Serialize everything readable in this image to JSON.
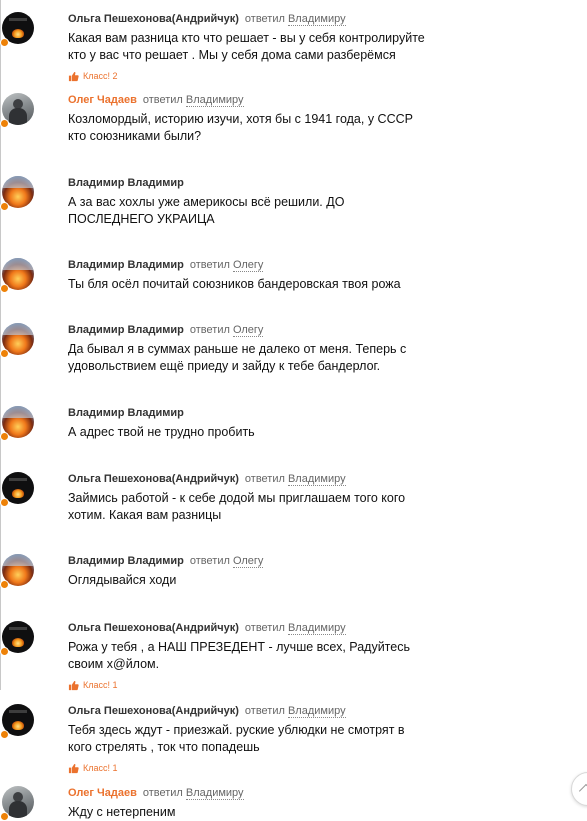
{
  "comments": [
    {
      "author": "Ольга Пешехонова(Андрийчук)",
      "author_orange": false,
      "reply_word": "ответил",
      "reply_to": "Владимиру",
      "avatar": "dark",
      "lines": [
        "Какая вам разница кто что решает - вы у себя контролируйте",
        "кто у вас что решает . Мы у себя дома сами разберёмся"
      ],
      "likes": "Класс! 2"
    },
    {
      "author": "Олег Чадаев",
      "author_orange": true,
      "reply_word": "ответил",
      "reply_to": "Владимиру",
      "avatar": "photo",
      "lines": [
        "Козломордый, историю изучи, хотя бы с 1941 года, у СССР",
        "кто союзниками были?"
      ],
      "likes": null
    },
    {
      "author": "Владимир Владимир",
      "author_orange": false,
      "reply_word": null,
      "reply_to": null,
      "avatar": "fire",
      "lines": [
        "А за вас хохлы уже америкосы всё решили. ДО",
        "ПОСЛЕДНЕГО УКРАИЦА"
      ],
      "likes": null
    },
    {
      "author": "Владимир Владимир",
      "author_orange": false,
      "reply_word": "ответил",
      "reply_to": "Олегу",
      "avatar": "fire",
      "lines": [
        "Ты бля осёл почитай союзников бандеровская твоя рожа"
      ],
      "likes": null
    },
    {
      "author": "Владимир Владимир",
      "author_orange": false,
      "reply_word": "ответил",
      "reply_to": "Олегу",
      "avatar": "fire",
      "lines": [
        "Да бывал я в суммах раньше не далеко от меня. Теперь с",
        "удовольствием ещё приеду и зайду к тебе бандерлог."
      ],
      "likes": null
    },
    {
      "author": "Владимир Владимир",
      "author_orange": false,
      "reply_word": null,
      "reply_to": null,
      "avatar": "fire",
      "lines": [
        "А адрес твой не трудно пробить"
      ],
      "likes": null
    },
    {
      "author": "Ольга Пешехонова(Андрийчук)",
      "author_orange": false,
      "reply_word": "ответил",
      "reply_to": "Владимиру",
      "avatar": "dark",
      "lines": [
        "Займись работой - к себе додой мы приглашаем того кого",
        "хотим. Какая вам разницы"
      ],
      "likes": null
    },
    {
      "author": "Владимир Владимир",
      "author_orange": false,
      "reply_word": "ответил",
      "reply_to": "Олегу",
      "avatar": "fire",
      "lines": [
        "Оглядывайся ходи"
      ],
      "likes": null
    },
    {
      "author": "Ольга Пешехонова(Андрийчук)",
      "author_orange": false,
      "reply_word": "ответил",
      "reply_to": "Владимиру",
      "avatar": "dark",
      "lines": [
        "Рожа у тебя , а НАШ ПРЕЗЕДЕНТ - лучше всех, Радуйтесь",
        "своим х@йлом."
      ],
      "likes": "Класс! 1"
    },
    {
      "author": "Ольга Пешехонова(Андрийчук)",
      "author_orange": false,
      "reply_word": "ответил",
      "reply_to": "Владимиру",
      "avatar": "dark",
      "lines": [
        "Тебя здесь ждут - приезжай. руские ублюдки не смотрят в",
        "кого стрелять , ток что попадешь"
      ],
      "likes": "Класс! 1"
    },
    {
      "author": "Олег Чадаев",
      "author_orange": true,
      "reply_word": "ответил",
      "reply_to": "Владимиру",
      "avatar": "photo",
      "lines": [
        "Жду с нетерпеним"
      ],
      "likes": null
    }
  ],
  "colors": {
    "accent": "#eb722e",
    "online": "#ee8208"
  },
  "icons": {
    "like": "thumbs-up-icon",
    "scroll": "chevron-up-icon"
  }
}
